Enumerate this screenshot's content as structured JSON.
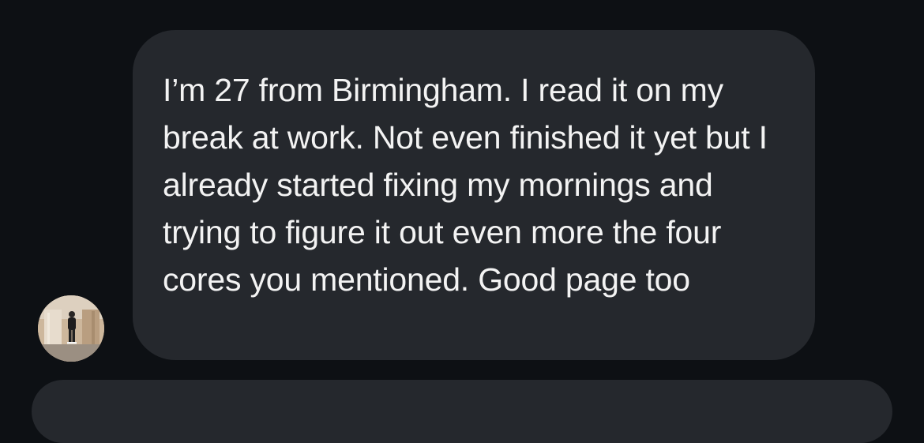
{
  "conversation": {
    "incoming_message": {
      "text": "I’m 27 from Birmingham. I read it on my break at work. Not even finished it yet but I already started fixing my mornings and trying to figure it out even more the four cores you mentioned. Good page too"
    },
    "avatar": {
      "icon": "user-avatar-photo"
    }
  },
  "colors": {
    "background": "#0d1014",
    "bubble": "#25282d",
    "text": "#f3f3f3"
  }
}
